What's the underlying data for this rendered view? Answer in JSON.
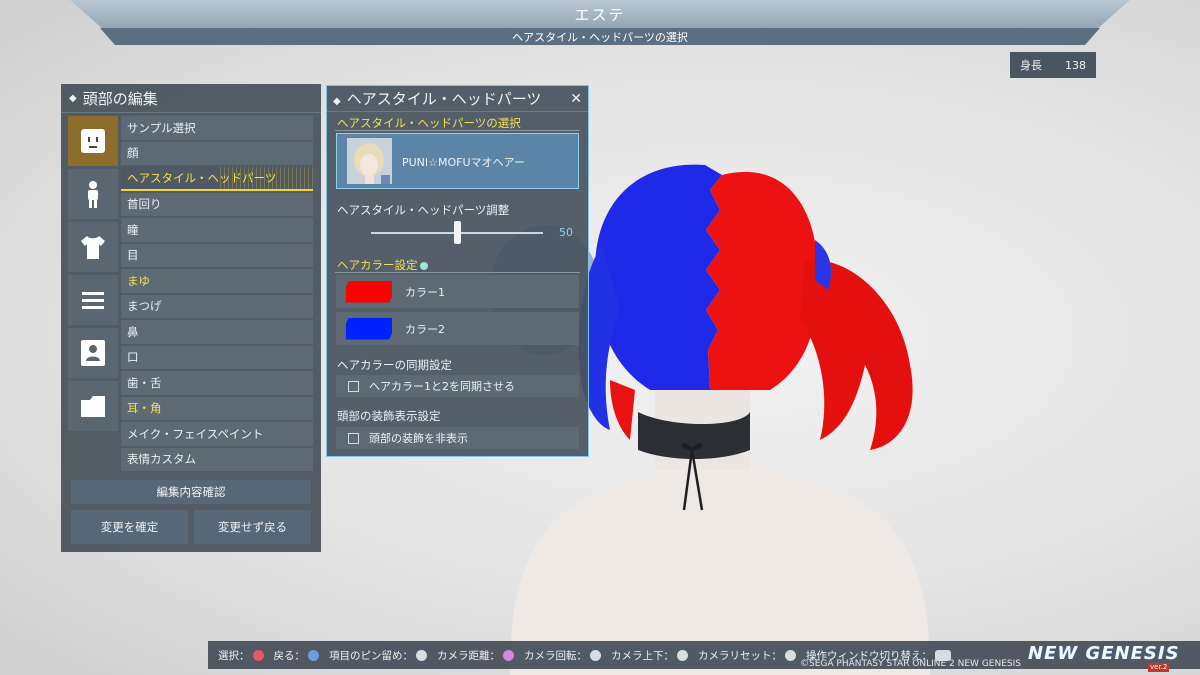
{
  "header": {
    "title": "エステ",
    "subtitle": "ヘアスタイル・ヘッドパーツの選択"
  },
  "stat": {
    "label": "身長",
    "value": "138"
  },
  "left_panel": {
    "title": "頭部の編集",
    "category_icons": [
      "face-icon",
      "body-icon",
      "shirt-icon",
      "menu-lines-icon",
      "id-card-icon",
      "folder-icon"
    ],
    "menu": [
      {
        "label": "サンプル選択",
        "state": "normal"
      },
      {
        "label": "顔",
        "state": "normal"
      },
      {
        "label": "ヘアスタイル・ヘッドパーツ",
        "state": "selected"
      },
      {
        "label": "首回り",
        "state": "normal"
      },
      {
        "label": "瞳",
        "state": "normal"
      },
      {
        "label": "目",
        "state": "normal"
      },
      {
        "label": "まゆ",
        "state": "highlight"
      },
      {
        "label": "まつげ",
        "state": "normal"
      },
      {
        "label": "鼻",
        "state": "normal"
      },
      {
        "label": "口",
        "state": "normal"
      },
      {
        "label": "歯・舌",
        "state": "normal"
      },
      {
        "label": "耳・角",
        "state": "highlight"
      },
      {
        "label": "メイク・フェイスペイント",
        "state": "normal"
      },
      {
        "label": "表情カスタム",
        "state": "normal"
      }
    ],
    "confirm_label": "編集内容確認",
    "apply_label": "変更を確定",
    "revert_label": "変更せず戻る"
  },
  "right_panel": {
    "title": "ヘアスタイル・ヘッドパーツ",
    "selection_heading": "ヘアスタイル・ヘッドパーツの選択",
    "selected_item": "PUNI☆MOFUマオヘアー",
    "adjust_heading": "ヘアスタイル・ヘッドパーツ調整",
    "slider_value": "50",
    "slider_fraction": 0.5,
    "color_heading": "ヘアカラー設定",
    "colors": [
      {
        "label": "カラー1",
        "hex": "#ff0000"
      },
      {
        "label": "カラー2",
        "hex": "#0022ff"
      }
    ],
    "sync_heading": "ヘアカラーの同期設定",
    "sync_option": "ヘアカラー1と2を同期させる",
    "sync_checked": false,
    "decor_heading": "頭部の装飾表示設定",
    "decor_option": "頭部の装飾を非表示",
    "decor_checked": false
  },
  "controls": [
    {
      "label": "選択：",
      "button": "circle"
    },
    {
      "label": "戻る：",
      "button": "cross"
    },
    {
      "label": "項目のピン留め：",
      "button": "L3"
    },
    {
      "label": "カメラ距離：",
      "button": "square"
    },
    {
      "label": "カメラ回転：",
      "button": "R"
    },
    {
      "label": "カメラ上下：",
      "button": "L"
    },
    {
      "label": "カメラリセット：",
      "button": "R3"
    },
    {
      "label": "操作ウィンドウ切り替え：",
      "button": "touchpad"
    }
  ],
  "footer": {
    "copyright": "©SEGA PHANTASY STAR ONLINE 2 NEW GENESIS",
    "logo": "NEW GENESIS",
    "logo_badge": "ver.2"
  },
  "theme": {
    "accent_yellow": "#f5e04a",
    "panel_border": "#7fc6e6",
    "hair_red": "#ff0000",
    "hair_blue": "#0022ff"
  }
}
